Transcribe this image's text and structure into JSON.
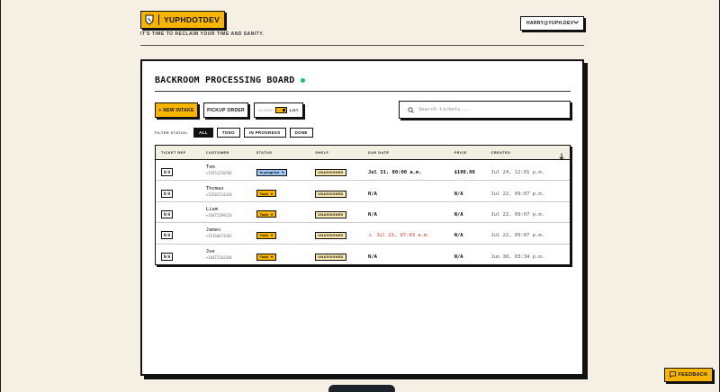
{
  "header": {
    "logo_text": "YUPHDOTDEV",
    "tagline": "IT'S TIME TO RECLAIM YOUR TIME AND SANITY.",
    "user_email": "HARRY@YUPH.DEV"
  },
  "board": {
    "title": "BACKROOM PROCESSING BOARD",
    "new_intake_label": "+ NEW INTAKE",
    "pickup_label": "PICKUP ORDER",
    "view_left": "BOARD",
    "view_right": "LIST",
    "search_placeholder": "Search tickets...",
    "filter_label": "FILTER STATUS:",
    "filters": [
      "ALL",
      "TODO",
      "IN PROGRESS",
      "DONE"
    ]
  },
  "table": {
    "columns": [
      "TICKET REF",
      "CUSTOMER",
      "STATUS",
      "SHELF",
      "DUE DATE",
      "PRICE",
      "CREATED"
    ],
    "rows": [
      {
        "ticket": "N/A",
        "name": "Tom",
        "phone": "+15551238769",
        "status": "In progress",
        "shelf": "UNASSIGNED",
        "due": "Jul 31, 00:00 a.m.",
        "price": "$100.00",
        "created": "Jul 24, 12:01 p.m."
      },
      {
        "ticket": "N/A",
        "name": "Thomas",
        "phone": "+12582233334",
        "status": "Todo",
        "shelf": "UNASSIGNED",
        "due": "N/A",
        "price": "N/A",
        "created": "Jul 22, 09:07 p.m."
      },
      {
        "ticket": "N/A",
        "name": "Liam",
        "phone": "+16472299224",
        "status": "Todo",
        "shelf": "UNASSIGNED",
        "due": "N/A",
        "price": "N/A",
        "created": "Jul 22, 09:07 p.m."
      },
      {
        "ticket": "N/A",
        "name": "James",
        "phone": "+15158473345",
        "status": "Todo",
        "shelf": "UNASSIGNED",
        "due": "Jul 23, 07:43 a.m.",
        "price": "N/A",
        "created": "Jul 22, 09:07 p.m."
      },
      {
        "ticket": "N/A",
        "name": "Joe",
        "phone": "+16472342344",
        "status": "Todo",
        "shelf": "UNASSIGNED",
        "due": "N/A",
        "price": "N/A",
        "created": "Jun 30, 03:34 p.m."
      }
    ]
  },
  "feedback_label": "FEEDBACK",
  "colors": {
    "accent": "#f7b500",
    "background": "#f5f0e3",
    "live": "#18c55a",
    "overdue": "#e0332a",
    "in_progress": "#9cc6f7"
  }
}
